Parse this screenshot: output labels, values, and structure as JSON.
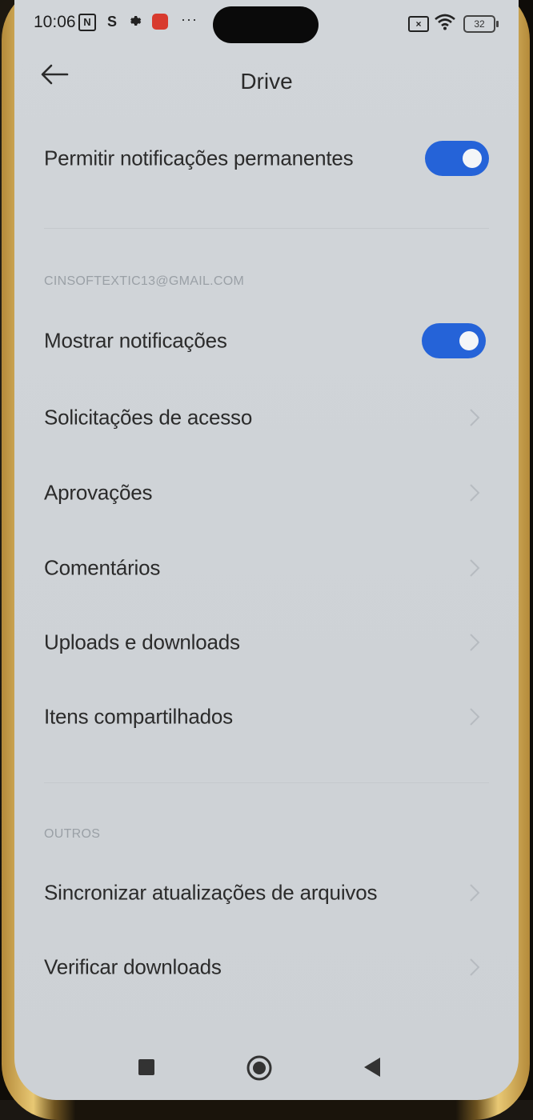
{
  "status_bar": {
    "time": "10:06",
    "icons": [
      "nfc-icon",
      "s-icon",
      "gear-icon",
      "app-notification-icon",
      "more-icon",
      "sim-off-icon",
      "wifi-icon",
      "battery-icon"
    ],
    "nfc_glyph": "N",
    "s_glyph": "S",
    "more_glyph": "···",
    "sim_glyph": "×",
    "battery_level": "32"
  },
  "header": {
    "title": "Drive",
    "back_icon": "arrow-left-icon"
  },
  "settings": {
    "permanent_notifications": {
      "label": "Permitir notificações permanentes",
      "enabled": true
    },
    "account_section": {
      "header": "CINSOFTEXTIC13@GMAIL.COM",
      "items": [
        {
          "label": "Mostrar notificações",
          "type": "toggle",
          "enabled": true
        },
        {
          "label": "Solicitações de acesso",
          "type": "link"
        },
        {
          "label": "Aprovações",
          "type": "link"
        },
        {
          "label": "Comentários",
          "type": "link"
        },
        {
          "label": "Uploads e downloads",
          "type": "link"
        },
        {
          "label": "Itens compartilhados",
          "type": "link"
        }
      ]
    },
    "others_section": {
      "header": "OUTROS",
      "items": [
        {
          "label": "Sincronizar atualizações de arquivos",
          "type": "link"
        },
        {
          "label": "Verificar downloads",
          "type": "link"
        }
      ]
    }
  },
  "nav_bar": {
    "icons": [
      "recents-square-icon",
      "home-circle-icon",
      "back-triangle-icon"
    ]
  },
  "colors": {
    "accent": "#2563d8",
    "background": "#cfd3d7",
    "text": "#2b2b2b",
    "secondary_text": "#9aa0a6"
  }
}
